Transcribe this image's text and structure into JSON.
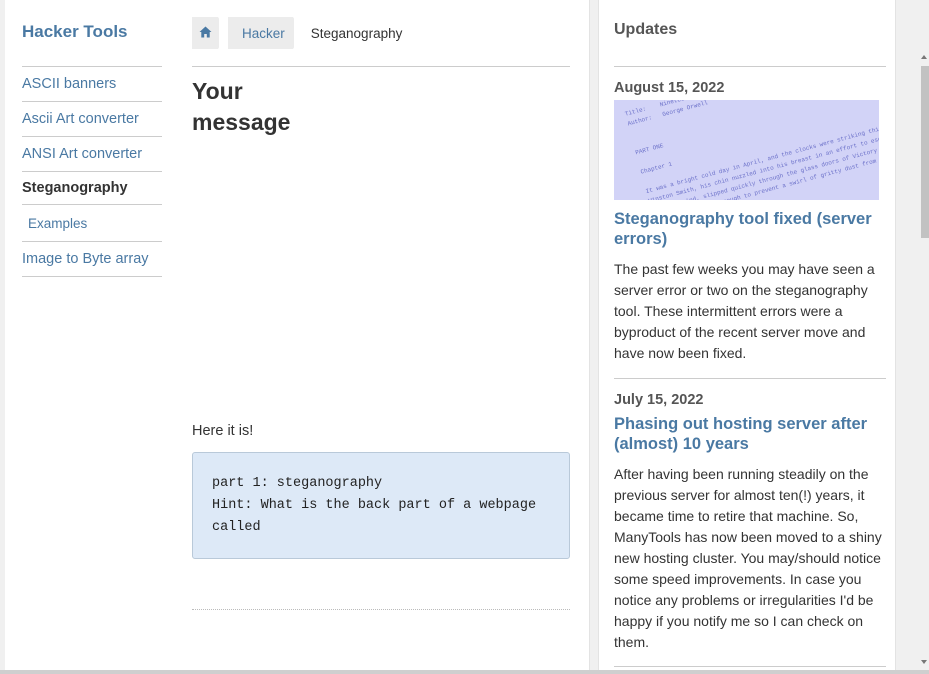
{
  "sidebar": {
    "title": "Hacker Tools",
    "items": [
      {
        "label": "ASCII banners"
      },
      {
        "label": "Ascii Art converter"
      },
      {
        "label": "ANSI Art converter"
      },
      {
        "label": "Steganography"
      },
      {
        "label": "Examples"
      },
      {
        "label": "Image to Byte array"
      }
    ]
  },
  "breadcrumb": {
    "home_icon": "home-icon",
    "items": [
      "Hacker",
      "Steganography"
    ]
  },
  "main": {
    "title_line1": "Your",
    "title_line2": "message",
    "intro": "Here it is!",
    "message": "part 1: steganography\nHint: What is the back part of a webpage called"
  },
  "updates": {
    "title": "Updates",
    "posts": [
      {
        "date": "August 15, 2022",
        "title": "Steganography tool fixed (server errors)",
        "body": "The past few weeks you may have seen a server error or two on the steganography tool. These intermittent errors were a byproduct of the recent server move and have now been fixed.",
        "image_text": "Title:    Nineteen Eighty-Four\nAuthor:   George Orwell\n\n\nPART ONE\n\nChapter 1\n\nIt was a bright cold day in April, and the clocks were striking thirteen.\nWinston Smith, his chin nuzzled into his breast in an effort to escape\nthe vile wind, slipped quickly through the glass doors of Victory Mansions,\nthough not quickly enough to prevent a swirl of gritty dust from entering"
      },
      {
        "date": "July 15, 2022",
        "title": "Phasing out hosting server after (almost) 10 years",
        "body": "After having been running steadily on the previous server for almost ten(!) years, it became time to retire that machine. So, ManyTools has now been moved to a shiny new hosting cluster. You may/should notice some speed improvements. In case you notice any problems or irregularities I'd be happy if you notify me so I can check on them."
      }
    ]
  },
  "colors": {
    "link": "#4a79a3",
    "code_bg": "#dde9f7",
    "image_bg": "#d2d3f7"
  }
}
